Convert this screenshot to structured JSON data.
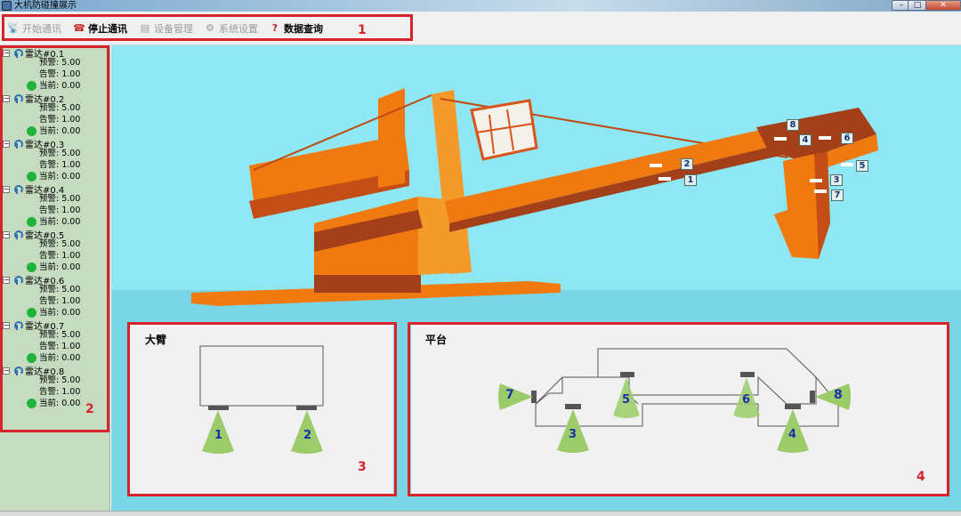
{
  "window": {
    "title": "大机防碰撞展示",
    "controls": {
      "minimize": "–",
      "maximize": "□",
      "close": "✕"
    }
  },
  "toolbar": {
    "items": [
      {
        "label": "开始通讯",
        "icon": "antenna-icon",
        "enabled": false
      },
      {
        "label": "停止通讯",
        "icon": "phone-icon",
        "enabled": true
      },
      {
        "label": "设备管理",
        "icon": "device-icon",
        "enabled": false
      },
      {
        "label": "系统设置",
        "icon": "settings-icon",
        "enabled": false
      },
      {
        "label": "数据查询",
        "icon": "query-icon",
        "enabled": true
      }
    ]
  },
  "sidebar": {
    "radars": [
      {
        "name": "雷达#0.1",
        "warn": "预警: 5.00",
        "alarm": "告警: 1.00",
        "current": "当前: 0.00",
        "status_color": "#1fb33a"
      },
      {
        "name": "雷达#0.2",
        "warn": "预警: 5.00",
        "alarm": "告警: 1.00",
        "current": "当前: 0.00",
        "status_color": "#1fb33a"
      },
      {
        "name": "雷达#0.3",
        "warn": "预警: 5.00",
        "alarm": "告警: 1.00",
        "current": "当前: 0.00",
        "status_color": "#1fb33a"
      },
      {
        "name": "雷达#0.4",
        "warn": "预警: 5.00",
        "alarm": "告警: 1.00",
        "current": "当前: 0.00",
        "status_color": "#1fb33a"
      },
      {
        "name": "雷达#0.5",
        "warn": "预警: 5.00",
        "alarm": "告警: 1.00",
        "current": "当前: 0.00",
        "status_color": "#1fb33a"
      },
      {
        "name": "雷达#0.6",
        "warn": "预警: 5.00",
        "alarm": "告警: 1.00",
        "current": "当前: 0.00",
        "status_color": "#1fb33a"
      },
      {
        "name": "雷达#0.7",
        "warn": "预警: 5.00",
        "alarm": "告警: 1.00",
        "current": "当前: 0.00",
        "status_color": "#1fb33a"
      },
      {
        "name": "雷达#0.8",
        "warn": "预警: 5.00",
        "alarm": "告警: 1.00",
        "current": "当前: 0.00",
        "status_color": "#1fb33a"
      }
    ]
  },
  "scene": {
    "radar_tags": [
      "1",
      "2",
      "3",
      "4",
      "5",
      "6",
      "7",
      "8"
    ]
  },
  "panels": {
    "boom": {
      "title": "大臂",
      "sensors": [
        "1",
        "2"
      ]
    },
    "platform": {
      "title": "平台",
      "sensors": [
        "3",
        "4",
        "5",
        "6",
        "7",
        "8"
      ]
    }
  },
  "annotations": [
    "1",
    "2",
    "3",
    "4"
  ],
  "colors": {
    "highlight": "#d8232a",
    "sensor_cone": "#9ccc6a",
    "sensor_label": "#1a2fa8",
    "crane_orange": "#f07a10",
    "crane_dark": "#a3401a"
  }
}
